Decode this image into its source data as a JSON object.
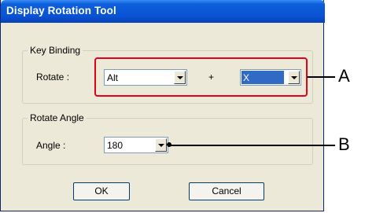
{
  "window": {
    "title": "Display Rotation Tool"
  },
  "key_binding": {
    "group_label": "Key Binding",
    "rotate_label": "Rotate :",
    "modifier_value": "Alt",
    "plus": "+",
    "key_value": "X"
  },
  "rotate_angle": {
    "group_label": "Rotate Angle",
    "angle_label": "Angle :",
    "angle_value": "180"
  },
  "buttons": {
    "ok_label": "OK",
    "cancel_label": "Cancel"
  },
  "callouts": {
    "a_label": "A",
    "b_label": "B",
    "highlight_color": "#e2001a"
  }
}
